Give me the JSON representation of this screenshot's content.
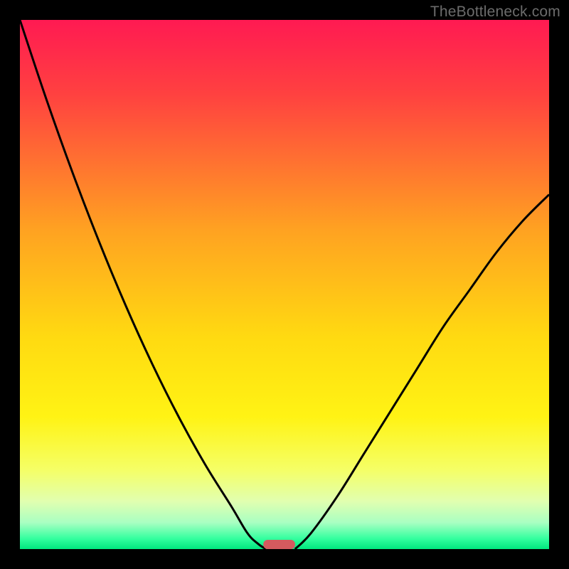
{
  "watermark": "TheBottleneck.com",
  "chart_data": {
    "type": "line",
    "title": "",
    "xlabel": "",
    "ylabel": "",
    "xlim": [
      0,
      100
    ],
    "ylim": [
      0,
      100
    ],
    "background_gradient": {
      "stops": [
        {
          "offset": 0,
          "color": "#ff1a52"
        },
        {
          "offset": 14,
          "color": "#ff4140"
        },
        {
          "offset": 40,
          "color": "#ffa321"
        },
        {
          "offset": 60,
          "color": "#ffda11"
        },
        {
          "offset": 75,
          "color": "#fff314"
        },
        {
          "offset": 85,
          "color": "#f5ff66"
        },
        {
          "offset": 91,
          "color": "#e1ffb0"
        },
        {
          "offset": 95,
          "color": "#a9ffc2"
        },
        {
          "offset": 98,
          "color": "#34ff9f"
        },
        {
          "offset": 100,
          "color": "#00e77e"
        }
      ]
    },
    "series": [
      {
        "name": "left-curve",
        "x": [
          0,
          5,
          10,
          15,
          20,
          25,
          30,
          35,
          40,
          43,
          45,
          46.5
        ],
        "values": [
          100,
          85,
          71,
          58,
          46,
          35,
          25,
          16,
          8,
          3,
          1,
          0
        ]
      },
      {
        "name": "right-curve",
        "x": [
          52,
          55,
          60,
          65,
          70,
          75,
          80,
          85,
          90,
          95,
          100
        ],
        "values": [
          0,
          3,
          10,
          18,
          26,
          34,
          42,
          49,
          56,
          62,
          67
        ]
      }
    ],
    "marker": {
      "name": "bottleneck-marker",
      "x_center": 49,
      "width": 6,
      "color": "#d45a5e"
    }
  }
}
